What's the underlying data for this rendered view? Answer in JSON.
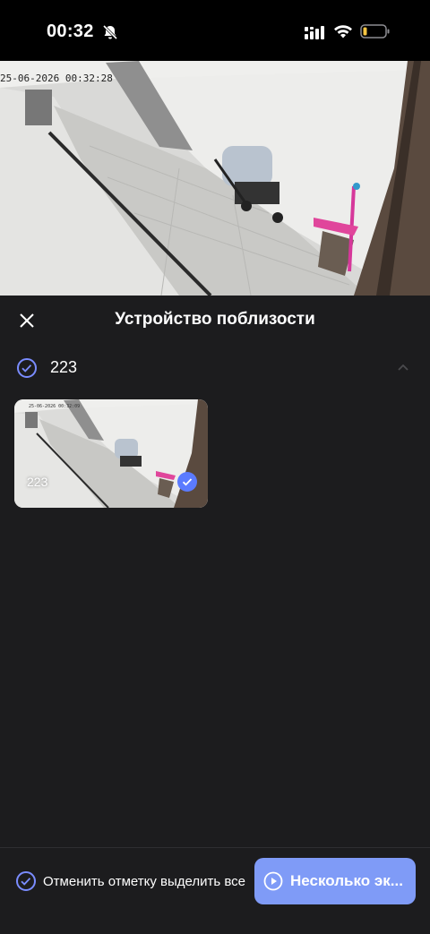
{
  "status_bar": {
    "time": "00:32",
    "icons": [
      "bell-slash-icon",
      "cellular-signal-icon",
      "wifi-icon",
      "battery-low-icon"
    ],
    "battery_color": "#f5c542"
  },
  "camera": {
    "timestamp": "25-06-2026 00:32:28"
  },
  "sheet": {
    "title": "Устройство поблизости",
    "close_icon": "close-icon"
  },
  "group": {
    "label": "223",
    "checked": true,
    "expanded": true
  },
  "devices": [
    {
      "label": "223",
      "checked": true
    }
  ],
  "footer": {
    "select_label": "Отменить отметку выделить все",
    "primary_label": "Несколько эк..."
  },
  "colors": {
    "accent": "#7a8cff",
    "check_fill": "#5b7bff",
    "button": "#7f9bf7",
    "background": "#1c1c1e"
  }
}
